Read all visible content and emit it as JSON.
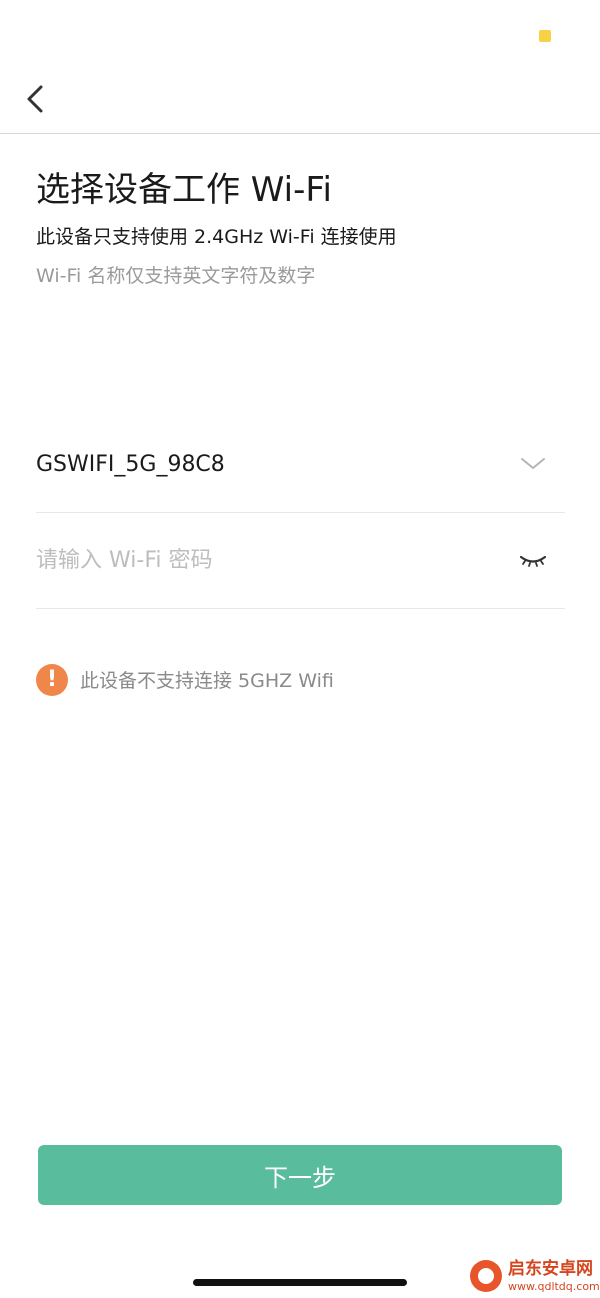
{
  "colors": {
    "accent": "#59bd9d",
    "warning": "#f0874a",
    "status_dot": "#f7d246"
  },
  "nav": {
    "back_icon": "chevron-left-icon"
  },
  "page": {
    "title": "选择设备工作 Wi-Fi",
    "subtitle": "此设备只支持使用 2.4GHz Wi-Fi 连接使用",
    "hint": "Wi-Fi 名称仅支持英文字符及数字"
  },
  "wifi_select": {
    "value": "GSWIFI_5G_98C8",
    "icon": "chevron-down-icon"
  },
  "password": {
    "value": "",
    "placeholder": "请输入 Wi-Fi 密码",
    "toggle_icon": "eye-closed-icon"
  },
  "warning": {
    "icon_glyph": "!",
    "text": "此设备不支持连接 5GHZ Wifi"
  },
  "next_button": {
    "label": "下一步"
  },
  "watermark": {
    "name": "启东安卓网",
    "url": "www.qdltdq.com"
  }
}
